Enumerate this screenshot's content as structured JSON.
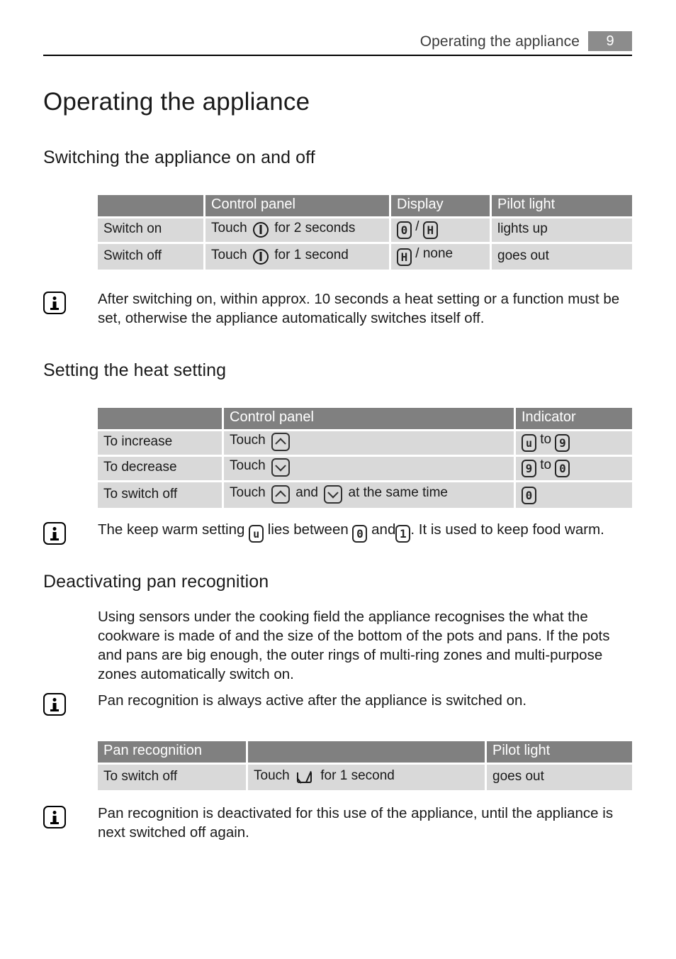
{
  "header": {
    "running_title": "Operating the appliance",
    "page_number": "9"
  },
  "headings": {
    "h1": "Operating the appliance",
    "switching": "Switching the appliance on and off",
    "heat_setting": "Setting the heat setting",
    "pan_recognition": "Deactivating pan recognition"
  },
  "table_switching": {
    "headers": [
      "",
      "Control panel",
      "Display",
      "Pilot light"
    ],
    "rows": [
      {
        "action": "Switch on",
        "control_prefix": "Touch",
        "control_icon": "power-icon",
        "control_suffix": "for 2 seconds",
        "display_first": "0",
        "display_sep": "/",
        "display_second": "H",
        "pilot": "lights up"
      },
      {
        "action": "Switch off",
        "control_prefix": "Touch",
        "control_icon": "power-icon",
        "control_suffix": "for 1 second",
        "display_first": "H",
        "display_sep": "/",
        "display_second": "none",
        "pilot": "goes out"
      }
    ]
  },
  "note_autoswitch": "After switching on, within approx. 10 seconds a heat setting or a function must be set, otherwise the appliance automatically switches itself off.",
  "table_heat": {
    "headers": [
      "",
      "Control panel",
      "Indicator"
    ],
    "rows": [
      {
        "action": "To increase",
        "control_prefix": "Touch",
        "control_keys": [
          "up"
        ],
        "control_mid": "",
        "control_suffix": "",
        "indicator_from": "u",
        "indicator_word": "to",
        "indicator_to": "9"
      },
      {
        "action": "To decrease",
        "control_prefix": "Touch",
        "control_keys": [
          "down"
        ],
        "control_mid": "",
        "control_suffix": "",
        "indicator_from": "9",
        "indicator_word": "to",
        "indicator_to": "0"
      },
      {
        "action": "To switch off",
        "control_prefix": "Touch",
        "control_keys": [
          "up",
          "down"
        ],
        "control_mid": "and",
        "control_suffix": "at the same time",
        "indicator_from": "0",
        "indicator_word": "",
        "indicator_to": ""
      }
    ]
  },
  "note_keepwarm": {
    "part1": "The keep warm setting",
    "sym1": "u",
    "part2": "lies between",
    "sym2": "0",
    "part3": "and",
    "sym3": "1",
    "part4": ". It is used to keep food warm."
  },
  "para_pan": "Using sensors under the cooking field the appliance recognises the what the cookware is made of and the size of the bottom of the pots and pans. If the pots and pans are big enough, the outer rings of multi-ring zones and multi-purpose zones automatically switch on.",
  "note_pan_active": "Pan recognition is always active after the appliance is switched on.",
  "table_pan": {
    "headers": [
      "Pan recognition",
      "",
      "Pilot light"
    ],
    "rows": [
      {
        "action": "To switch off",
        "control_prefix": "Touch",
        "control_icon": "pan-recognition-icon",
        "control_suffix": "for 1 second",
        "pilot": "goes out"
      }
    ]
  },
  "note_pan_deactivated": "Pan recognition is deactivated for this use of the appliance, until the appliance is next switched off again.",
  "colors": {
    "table_header_bg": "#808080",
    "table_row_bg": "#d9d9d9",
    "page_badge_bg": "#8c8c8c",
    "text": "#1a1a1a",
    "rule": "#000000"
  }
}
